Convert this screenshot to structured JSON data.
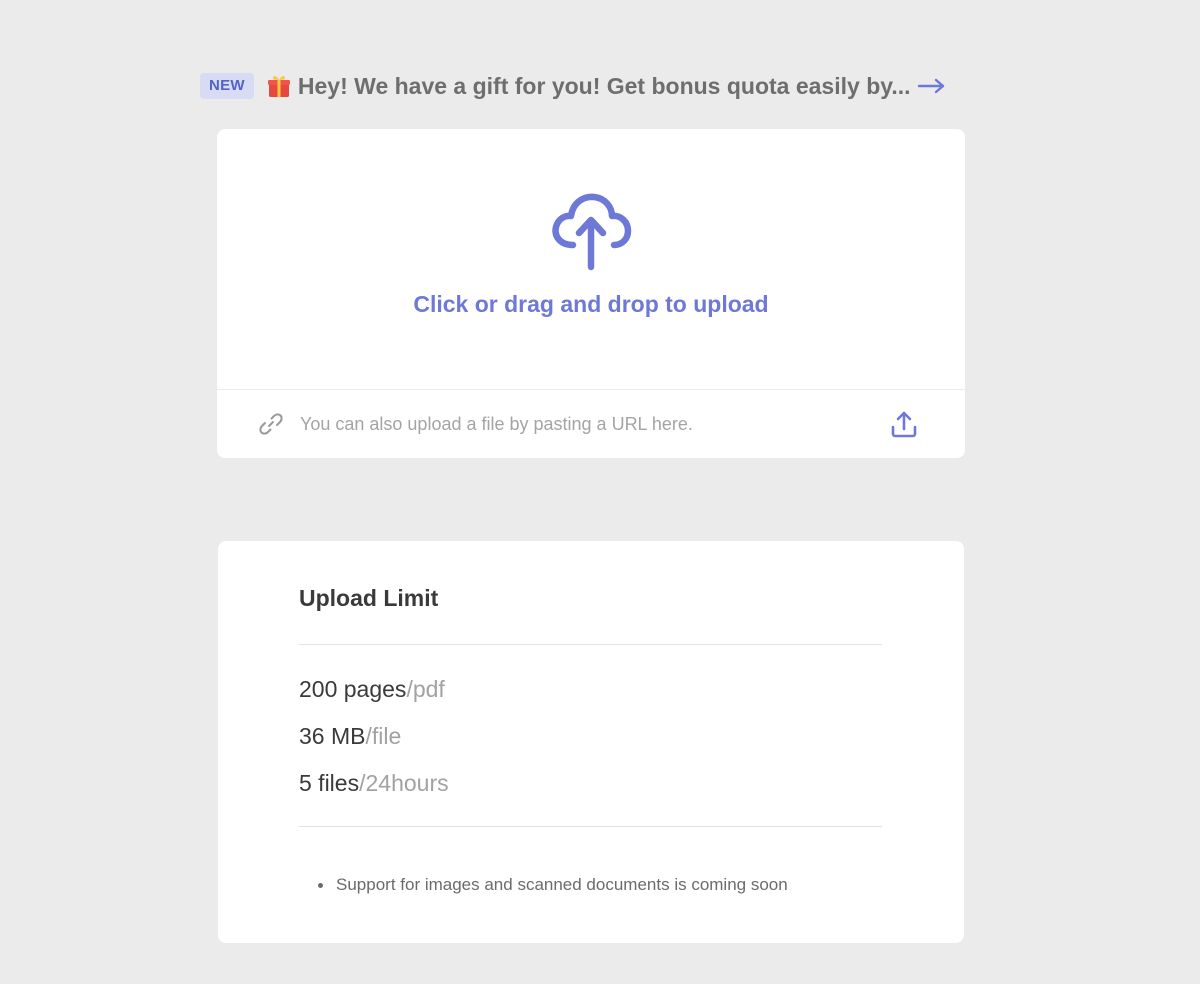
{
  "banner": {
    "badge": "NEW",
    "text": "Hey! We have a gift for you! Get bonus quota easily by...",
    "gift_icon": "gift-icon",
    "arrow_icon": "arrow-right-icon"
  },
  "upload": {
    "drop_label": "Click or drag and drop to upload",
    "cloud_icon": "cloud-upload-icon",
    "url_placeholder": "You can also upload a file by pasting a URL here.",
    "url_value": "",
    "link_icon": "link-icon",
    "submit_icon": "upload-icon"
  },
  "limits": {
    "title": "Upload Limit",
    "items": [
      {
        "value": "200 pages",
        "unit": "/pdf"
      },
      {
        "value": "36 MB",
        "unit": "/file"
      },
      {
        "value": "5 files",
        "unit": "/24hours"
      }
    ],
    "note": "Support for images and scanned documents is coming soon"
  },
  "colors": {
    "accent": "#6d78d7",
    "background": "#ebebeb",
    "card": "#ffffff",
    "badge_bg": "#d7dbf3"
  }
}
